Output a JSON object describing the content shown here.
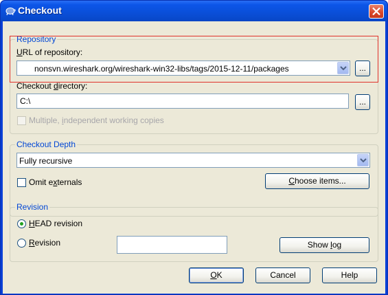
{
  "window": {
    "title": "Checkout"
  },
  "repository": {
    "group_title": "Repository",
    "url_label_pre": "",
    "url_label_ul": "U",
    "url_label_post": "RL of repository:",
    "url_value": "nonsvn.wireshark.org/wireshark-win32-libs/tags/2015-12-11/packages",
    "url_browse": "...",
    "dir_label_pre": "Checkout ",
    "dir_label_ul": "d",
    "dir_label_post": "irectory:",
    "dir_value": "C:\\",
    "dir_browse": "...",
    "multi_label_pre": "Multiple, ",
    "multi_label_ul": "i",
    "multi_label_post": "ndependent working copies"
  },
  "depth": {
    "group_title": "Checkout Depth",
    "selected": "Fully recursive",
    "omit_pre": "Omit e",
    "omit_ul": "x",
    "omit_post": "ternals",
    "choose_pre": "",
    "choose_ul": "C",
    "choose_post": "hoose items..."
  },
  "revision": {
    "group_title": "Revision",
    "head_pre": "",
    "head_ul": "H",
    "head_post": "EAD revision",
    "rev_pre": "",
    "rev_ul": "R",
    "rev_post": "evision",
    "rev_value": "",
    "showlog_pre": "Show ",
    "showlog_ul": "l",
    "showlog_post": "og"
  },
  "buttons": {
    "ok_ul": "O",
    "ok_post": "K",
    "cancel": "Cancel",
    "help": "Help"
  },
  "colors": {
    "titlebar": "#0a4fd8",
    "dialog_bg": "#ece9d8",
    "group_title": "#0046d5",
    "highlight": "#e0312a"
  },
  "icons": [
    "tortoise-icon",
    "close-icon",
    "dropdown-arrow-icon"
  ]
}
